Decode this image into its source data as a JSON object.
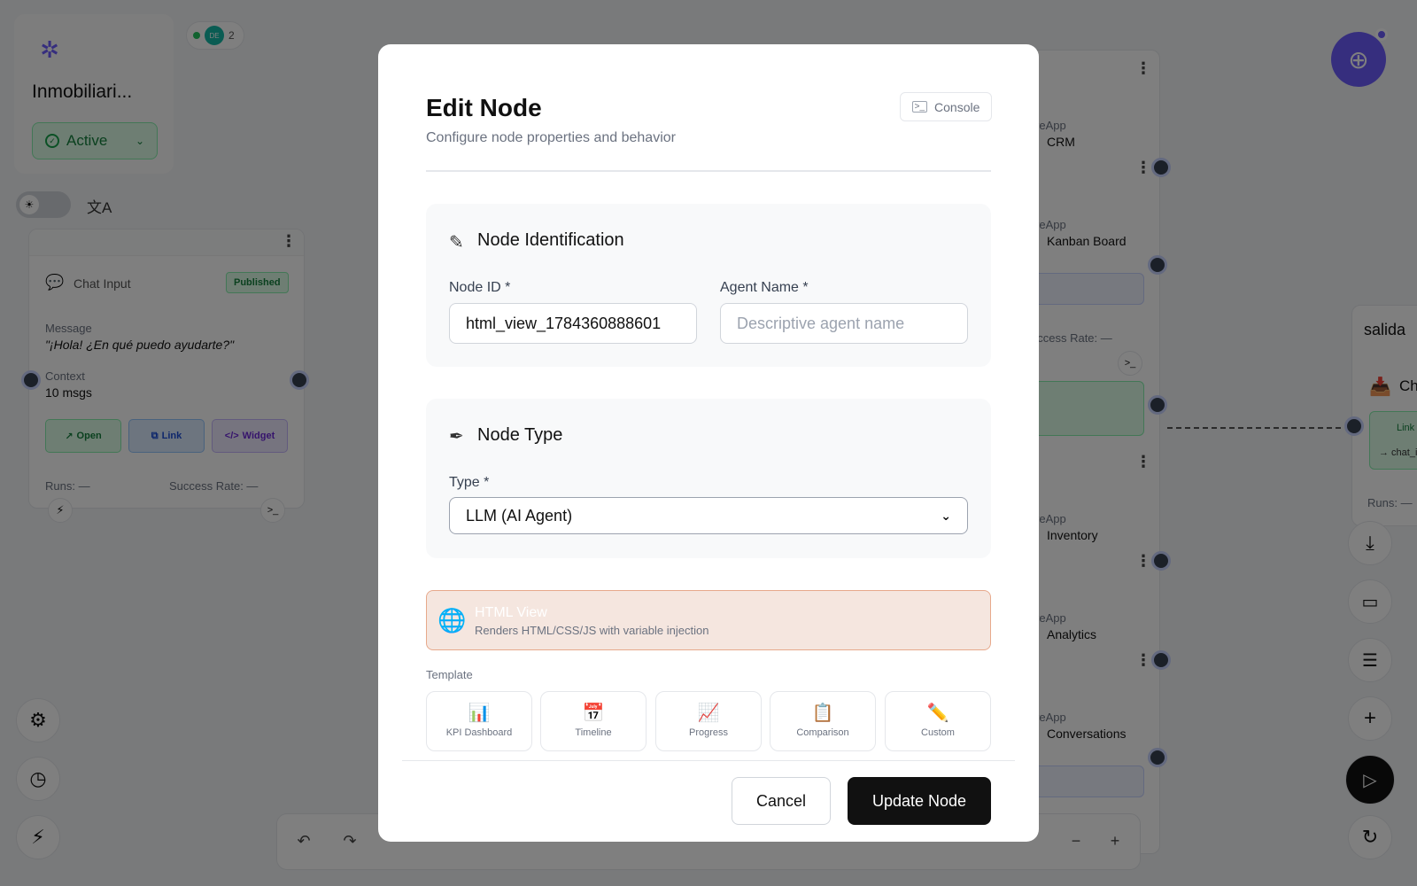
{
  "project": {
    "name": "Inmobiliari...",
    "status": "Active",
    "presence_initials": "DE",
    "presence_count": "2"
  },
  "chat_node": {
    "title": "Chat Input",
    "badge": "Published",
    "message_label": "Message",
    "message_value": "\"¡Hola! ¿En qué puedo ayudarte?\"",
    "context_label": "Context",
    "context_value": "10 msgs",
    "actions": [
      "Open",
      "Link",
      "Widget"
    ],
    "runs": "Runs: —",
    "success": "Success Rate: —"
  },
  "bg_nodes": [
    {
      "sub": "iveApp",
      "name": "CRM"
    },
    {
      "sub": "iveApp",
      "name": "Kanban Board"
    },
    {
      "sub": "iveApp",
      "name": "Inventory"
    },
    {
      "sub": "iveApp",
      "name": "Analytics"
    },
    {
      "sub": "iveApp",
      "name": "Conversations"
    }
  ],
  "bg_misc": {
    "success_rate": "uccess Rate: —"
  },
  "salida_node": {
    "title": "salida",
    "name": "Ch",
    "link": "Link",
    "output": "→ chat_i",
    "runs": "Runs: —"
  },
  "modal": {
    "title": "Edit Node",
    "subtitle": "Configure node properties and behavior",
    "console_label": "Console",
    "identification": {
      "title": "Node Identification",
      "node_id_label": "Node ID *",
      "node_id_value": "html_view_1784360888601",
      "agent_name_label": "Agent Name *",
      "agent_name_placeholder": "Descriptive agent name"
    },
    "node_type": {
      "title": "Node Type",
      "type_label": "Type *",
      "type_value": "LLM (AI Agent)"
    },
    "html_view": {
      "title": "HTML View",
      "description": "Renders HTML/CSS/JS with variable injection"
    },
    "template": {
      "label": "Template",
      "options": [
        {
          "icon": "📊",
          "label": "KPI Dashboard"
        },
        {
          "icon": "📅",
          "label": "Timeline"
        },
        {
          "icon": "📈",
          "label": "Progress"
        },
        {
          "icon": "📋",
          "label": "Comparison"
        },
        {
          "icon": "✏️",
          "label": "Custom"
        }
      ]
    },
    "cancel_label": "Cancel",
    "update_label": "Update Node"
  },
  "colors": {
    "accent": "#6d5dfc",
    "active_green": "#16a34a",
    "primary_button": "#111111",
    "html_view_bg": "#f5e6df"
  }
}
